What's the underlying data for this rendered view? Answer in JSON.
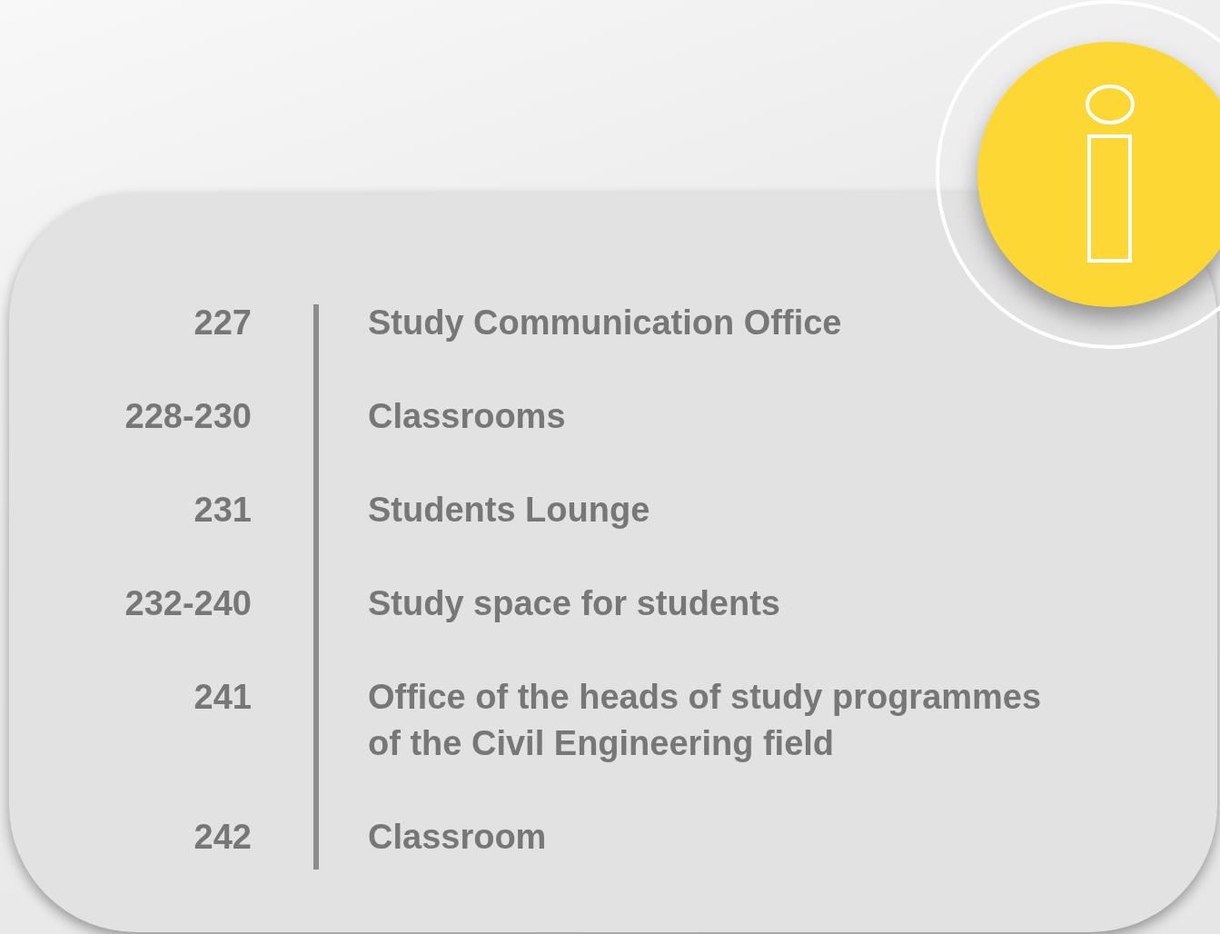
{
  "entries": [
    {
      "room": "227",
      "description": "Study Communication Office"
    },
    {
      "room": "228-230",
      "description": "Classrooms"
    },
    {
      "room": "231",
      "description": "Students Lounge"
    },
    {
      "room": "232-240",
      "description": "Study space for students"
    },
    {
      "room": "241",
      "description": "Office of the heads of study programmes\nof the Civil Engineering field"
    },
    {
      "room": "242",
      "description": "Classroom"
    }
  ]
}
